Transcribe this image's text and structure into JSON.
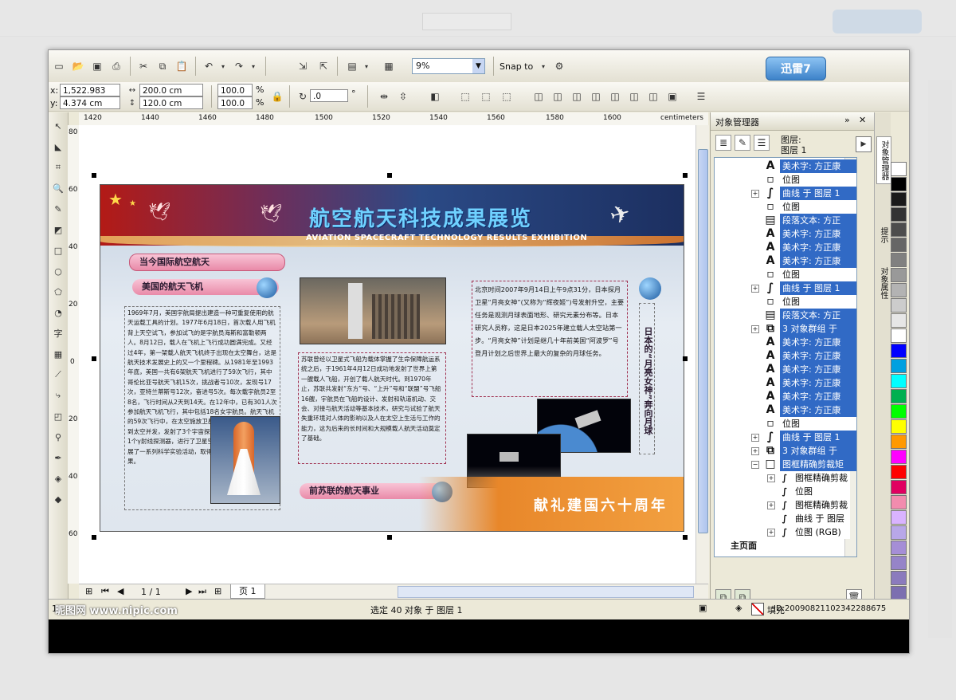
{
  "app": {
    "brand_badge": "迅雷7"
  },
  "toolbar": {
    "zoom": "9%",
    "snap_to": "Snap to",
    "x_label": "x:",
    "x_value": "1,522.983 cm",
    "y_label": "y:",
    "y_value": "4.374 cm",
    "w_value": "200.0 cm",
    "h_value": "120.0 cm",
    "scale_w": "100.0",
    "scale_h": "100.0",
    "percent": "%",
    "angle": ".0",
    "degree": "°"
  },
  "ruler": {
    "h_ticks": [
      "1420",
      "1440",
      "1460",
      "1480",
      "1500",
      "1520",
      "1540",
      "1560",
      "1580",
      "1600"
    ],
    "unit": "centimeters",
    "v_ticks": [
      "80",
      "60",
      "40",
      "20",
      "0",
      "20",
      "40",
      "60"
    ]
  },
  "poster": {
    "title": "航空航天科技成果展览",
    "subtitle": "AVIATION SPACECRAFT TECHNOLOGY RESULTS EXHIBITION",
    "pill1": "当今国际航空航天",
    "pill2": "美国的航天飞机",
    "pill3": "前苏联的航天事业",
    "banner_bottom": "献礼建国六十周年",
    "vertical_label": "日本的“月亮女神”奔向月球",
    "text_us": "1969年7月，美国宇航局提出建造一种可重复使用的航天运载工具的计划。1977年6月18日，首次载人用飞机背上天空试飞，参加试飞的是宇航员海斯和富勒顿两人。8月12日，载人在飞机上飞行成功圆满完成。又经过4年，第一架载人航天飞机终于出现在太空舞台，这是航天技术发展史上的又一个里程碑。从1981年至1993年底，美国一共有6架航天飞机进行了59次飞行，其中哥伦比亚号航天飞机15次，挑战者号10次，发现号17次，亚特兰蒂斯号12次，奋进号5次。每次载宇航员2至8名，飞行时间从2天到14天。在12年中，已有301人次参加航天飞机飞行，其中包括18名女宇航员。航天飞机的59次飞行中，在太空施放卫星50多颗，数2座空间站到太空并发，发射了3个宇宙探测器，1个空间望远镜和1个γ射线探测器，进行了卫星空间回收和空间修理，开展了一系列科学实验活动，取得了丰硕的探测实验成果。",
    "text_ussr": "苏联曾经以卫星式飞船为载体掌握了生命保障航运系统之后，于1961年4月12日成功地发射了世界上第一艘载人飞船，开创了载人航天时代。到1970年止，苏联共发射“东方”号、“上升”号和“联盟”号飞船16艘，宇航员在飞船的设计、发射和轨道机动、交会、对接与航天活动等基本技术，研究与试验了航天失重环境对人体的影响以及人在太空上生活与工作的能力，这为后来的长时间和大规模载人航天活动奠定了基础。",
    "text_jp": "北京时间2007年9月14日上午9点31分，日本探月卫星“月亮女神”(又称为“辉夜姬”)号发射升空，主要任务是观测月球表面地形、研究元素分布等。日本研究人员称，这是日本2025年建立载人太空站第一步。“月亮女神”计划是继几十年前美国“阿波罗”号登月计划之后世界上最大的复杂的月球任务。"
  },
  "page_nav": {
    "counter": "1 / 1",
    "tab": "页 1"
  },
  "docker": {
    "title": "对象管理器",
    "layer_label": "图层:",
    "layer_name": "图层 1",
    "rows": [
      {
        "glyph": "A",
        "text": "美术字: 方正康",
        "pm": ""
      },
      {
        "glyph": "▫",
        "text": "位图",
        "pm": ""
      },
      {
        "glyph": "∫",
        "text": "曲线 于 图层 1",
        "pm": "+"
      },
      {
        "glyph": "▫",
        "text": "位图",
        "pm": ""
      },
      {
        "glyph": "▤",
        "text": "段落文本: 方正",
        "pm": ""
      },
      {
        "glyph": "A",
        "text": "美术字: 方正康",
        "pm": ""
      },
      {
        "glyph": "A",
        "text": "美术字: 方正康",
        "pm": ""
      },
      {
        "glyph": "A",
        "text": "美术字: 方正康",
        "pm": ""
      },
      {
        "glyph": "▫",
        "text": "位图",
        "pm": ""
      },
      {
        "glyph": "∫",
        "text": "曲线 于 图层 1",
        "pm": "+"
      },
      {
        "glyph": "▫",
        "text": "位图",
        "pm": ""
      },
      {
        "glyph": "▤",
        "text": "段落文本: 方正",
        "pm": ""
      },
      {
        "glyph": "⧉",
        "text": "3 对象群组 于",
        "pm": "+"
      },
      {
        "glyph": "A",
        "text": "美术字: 方正康",
        "pm": ""
      },
      {
        "glyph": "A",
        "text": "美术字: 方正康",
        "pm": ""
      },
      {
        "glyph": "A",
        "text": "美术字: 方正康",
        "pm": ""
      },
      {
        "glyph": "A",
        "text": "美术字: 方正康",
        "pm": ""
      },
      {
        "glyph": "A",
        "text": "美术字: 方正康",
        "pm": ""
      },
      {
        "glyph": "A",
        "text": "美术字: 方正康",
        "pm": ""
      },
      {
        "glyph": "▫",
        "text": "位图",
        "pm": ""
      },
      {
        "glyph": "∫",
        "text": "曲线 于 图层 1",
        "pm": "+"
      },
      {
        "glyph": "⧉",
        "text": "3 对象群组 于",
        "pm": "+"
      },
      {
        "glyph": "□",
        "text": "图框精确剪裁矩",
        "pm": "−"
      }
    ],
    "subrows": [
      {
        "text": "图框精确剪裁",
        "pm": "+"
      },
      {
        "text": "位图",
        "pm": ""
      },
      {
        "text": "图框精确剪裁",
        "pm": "+"
      },
      {
        "text": "曲线 于 图层",
        "pm": ""
      },
      {
        "text": "位图 (RGB)",
        "pm": "+"
      }
    ],
    "master": "主页面"
  },
  "side_tabs": {
    "t1": "对象管理器",
    "t2": "提示",
    "t3": "对象属性"
  },
  "status": {
    "left": "1",
    "watermark": "昵图网 www.nipic.com",
    "center": "选定 40 对象 于 图层 1",
    "fill": "填充",
    "id": "ID:20090821102342288675"
  },
  "palette": [
    "#ffffff",
    "#000000",
    "#1a1a1a",
    "#333333",
    "#4d4d4d",
    "#666666",
    "#808080",
    "#999999",
    "#b3b3b3",
    "#cccccc",
    "#e6e6e6",
    "#ffffff",
    "#0000ff",
    "#00a0e0",
    "#00ffff",
    "#00b050",
    "#00ff00",
    "#ffff00",
    "#ff9900",
    "#ff00ff",
    "#ff0000",
    "#e00060",
    "#f28cae",
    "#d9b3ff",
    "#b8a7e8",
    "#a58ed6",
    "#9684c8",
    "#8b7bbd",
    "#7c6fb0"
  ],
  "colors": {
    "accent": "#316ac5",
    "banner_title": "#6fd1ff"
  }
}
